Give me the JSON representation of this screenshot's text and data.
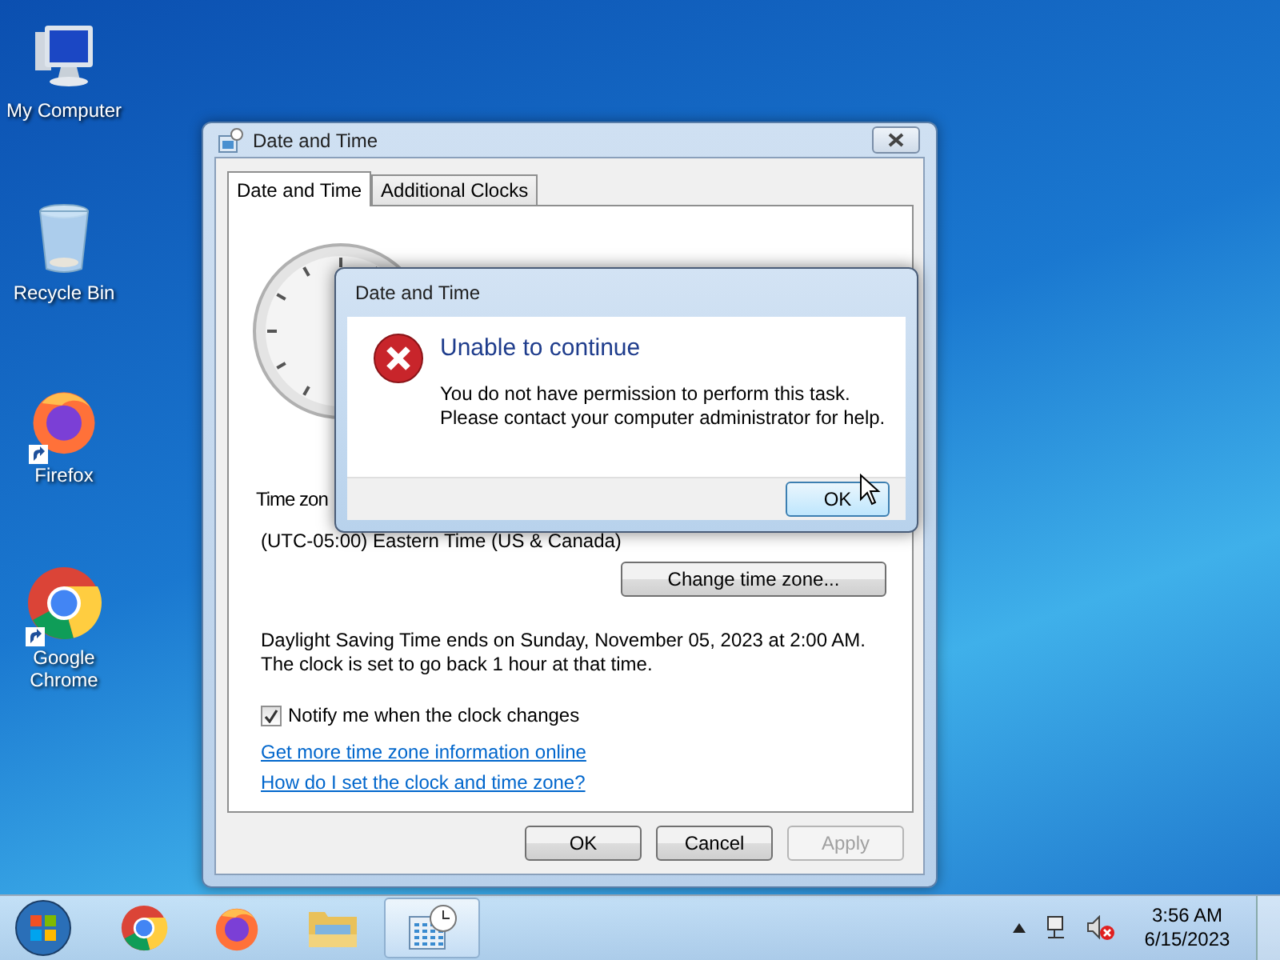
{
  "desktop_icons": [
    {
      "kind": "computer",
      "label": "My Computer",
      "shortcut": false
    },
    {
      "kind": "recycle",
      "label": "Recycle Bin",
      "shortcut": false
    },
    {
      "kind": "firefox",
      "label": "Firefox",
      "shortcut": true
    },
    {
      "kind": "chrome",
      "label": "Google Chrome",
      "shortcut": true
    }
  ],
  "window": {
    "title": "Date and Time",
    "tabs": [
      {
        "label": "Date and Time",
        "selected": true
      },
      {
        "label": "Additional Clocks",
        "selected": false
      }
    ],
    "time_zone_label": "Time zon",
    "time_zone": "(UTC-05:00) Eastern Time (US & Canada)",
    "change_button": "Change time zone...",
    "dst_text": "Daylight Saving Time ends on Sunday, November 05, 2023 at 2:00 AM. The clock is set to go back 1 hour at that time.",
    "notify": {
      "label": "Notify me when the clock changes",
      "checked": true
    },
    "links": [
      "Get more time zone information online",
      "How do I set the clock and time zone?"
    ],
    "buttons": [
      {
        "label": "OK",
        "disabled": false
      },
      {
        "label": "Cancel",
        "disabled": false
      },
      {
        "label": "Apply",
        "disabled": true
      }
    ]
  },
  "error_dialog": {
    "title": "Date and Time",
    "heading": "Unable to continue",
    "message": [
      "You do not have permission to perform this task.",
      "Please contact your computer administrator for help."
    ],
    "button": "OK"
  },
  "taskbar": {
    "items": [
      {
        "kind": "chrome",
        "active": false
      },
      {
        "kind": "firefox",
        "active": false
      },
      {
        "kind": "explorer",
        "active": false
      },
      {
        "kind": "datetime",
        "active": true
      }
    ],
    "time": "3:56 AM",
    "date": "6/15/2023"
  }
}
